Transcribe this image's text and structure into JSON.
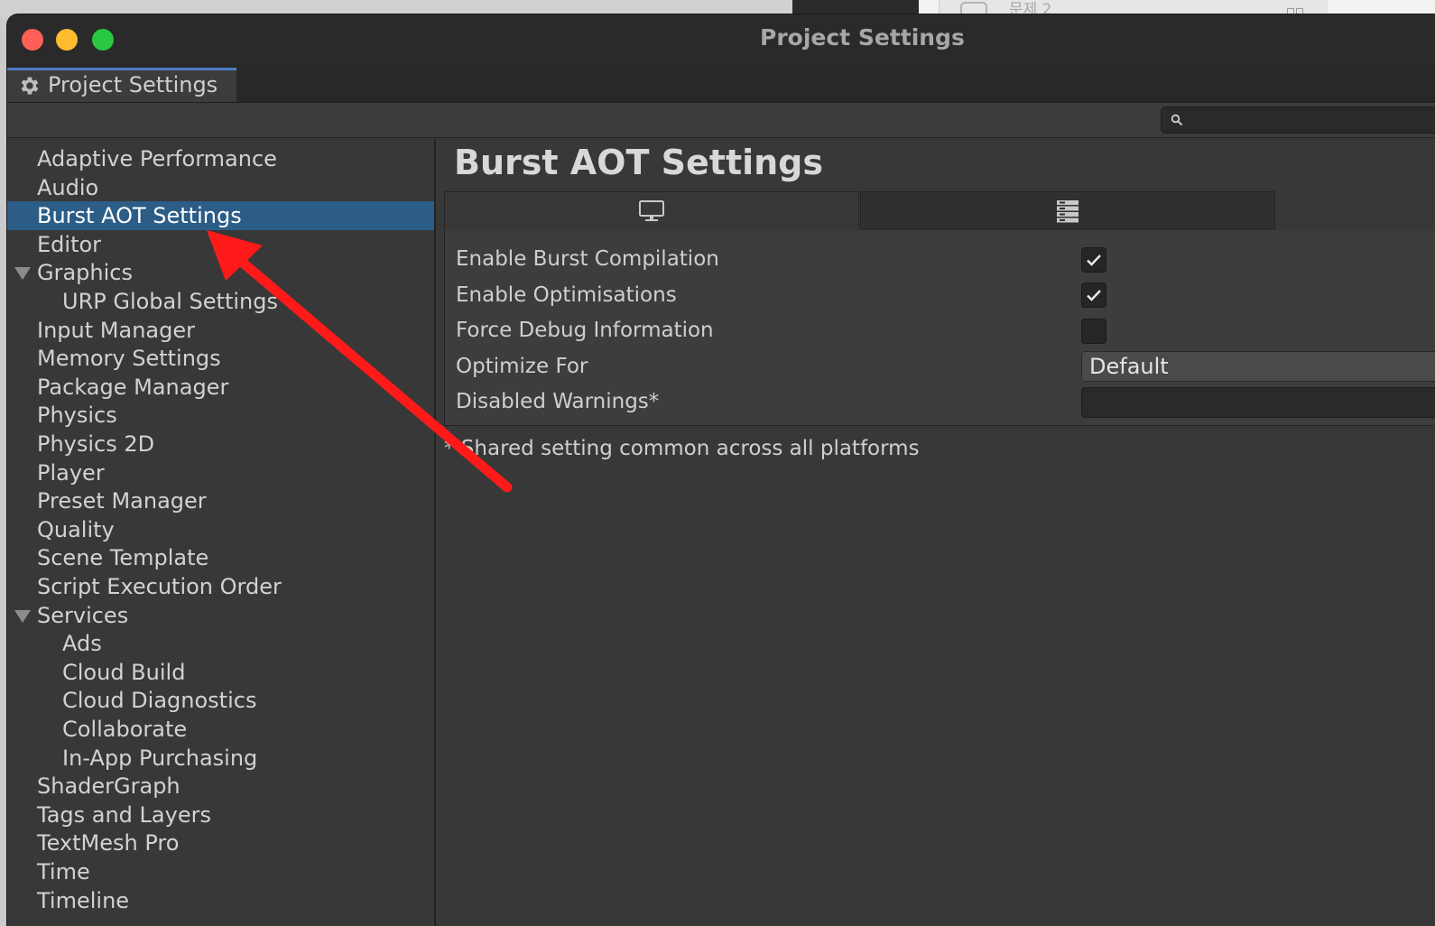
{
  "background": {
    "window_text": "문제 2"
  },
  "window": {
    "title": "Project Settings",
    "traffic_lights": [
      "close",
      "minimize",
      "zoom"
    ]
  },
  "tab": {
    "icon": "gear-icon",
    "label": "Project Settings"
  },
  "search": {
    "icon": "search-icon",
    "value": ""
  },
  "sidebar": {
    "selected": "Burst AOT Settings",
    "items": [
      {
        "label": "Adaptive Performance",
        "level": 0,
        "expandable": false
      },
      {
        "label": "Audio",
        "level": 0,
        "expandable": false
      },
      {
        "label": "Burst AOT Settings",
        "level": 0,
        "expandable": false
      },
      {
        "label": "Editor",
        "level": 0,
        "expandable": false
      },
      {
        "label": "Graphics",
        "level": 0,
        "expandable": true
      },
      {
        "label": "URP Global Settings",
        "level": 1,
        "expandable": false
      },
      {
        "label": "Input Manager",
        "level": 0,
        "expandable": false
      },
      {
        "label": "Memory Settings",
        "level": 0,
        "expandable": false
      },
      {
        "label": "Package Manager",
        "level": 0,
        "expandable": false
      },
      {
        "label": "Physics",
        "level": 0,
        "expandable": false
      },
      {
        "label": "Physics 2D",
        "level": 0,
        "expandable": false
      },
      {
        "label": "Player",
        "level": 0,
        "expandable": false
      },
      {
        "label": "Preset Manager",
        "level": 0,
        "expandable": false
      },
      {
        "label": "Quality",
        "level": 0,
        "expandable": false
      },
      {
        "label": "Scene Template",
        "level": 0,
        "expandable": false
      },
      {
        "label": "Script Execution Order",
        "level": 0,
        "expandable": false
      },
      {
        "label": "Services",
        "level": 0,
        "expandable": true
      },
      {
        "label": "Ads",
        "level": 1,
        "expandable": false
      },
      {
        "label": "Cloud Build",
        "level": 1,
        "expandable": false
      },
      {
        "label": "Cloud Diagnostics",
        "level": 1,
        "expandable": false
      },
      {
        "label": "Collaborate",
        "level": 1,
        "expandable": false
      },
      {
        "label": "In-App Purchasing",
        "level": 1,
        "expandable": false
      },
      {
        "label": "ShaderGraph",
        "level": 0,
        "expandable": false
      },
      {
        "label": "Tags and Layers",
        "level": 0,
        "expandable": false
      },
      {
        "label": "TextMesh Pro",
        "level": 0,
        "expandable": false
      },
      {
        "label": "Time",
        "level": 0,
        "expandable": false
      },
      {
        "label": "Timeline",
        "level": 0,
        "expandable": false
      }
    ]
  },
  "main": {
    "title": "Burst AOT Settings",
    "platform_tabs": [
      {
        "icon": "desktop-icon"
      },
      {
        "icon": "dedicated-server-icon"
      }
    ],
    "settings": {
      "enable_burst_compilation": {
        "label": "Enable Burst Compilation",
        "checked": true
      },
      "enable_optimisations": {
        "label": "Enable Optimisations",
        "checked": true
      },
      "force_debug_information": {
        "label": "Force Debug Information",
        "checked": false
      },
      "optimize_for": {
        "label": "Optimize For",
        "value": "Default"
      },
      "disabled_warnings": {
        "label": "Disabled Warnings*",
        "value": ""
      }
    },
    "footnote": "* Shared setting common across all platforms"
  },
  "annotation": {
    "type": "arrow",
    "color": "#ff1a1a",
    "points_to": "Burst AOT Settings"
  }
}
